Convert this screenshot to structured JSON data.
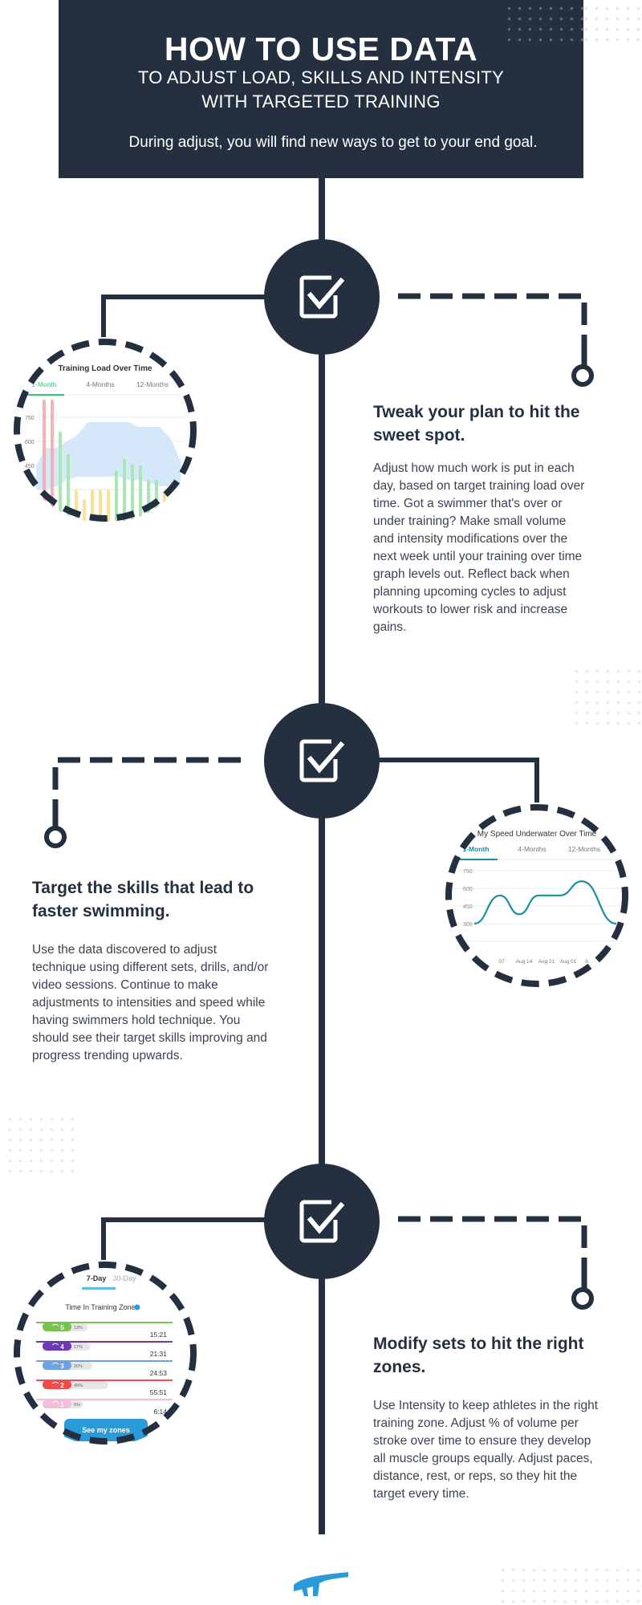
{
  "header": {
    "title": "HOW TO USE DATA",
    "subtitle_line1": "TO ADJUST LOAD, SKILLS AND INTENSITY",
    "subtitle_line2": "WITH TARGETED TRAINING",
    "tagline": "During adjust, you will find new ways to get to your end goal."
  },
  "colors": {
    "navy": "#243040",
    "green": "#2ecc71",
    "teal": "#1a8fa0",
    "blue": "#2a9ad8"
  },
  "icons": {
    "step_icon": "checkbox-checked-icon",
    "end_icon": "circle-terminal-icon",
    "logo": "brand-logo"
  },
  "sections": [
    {
      "title": "Tweak your plan to hit the sweet spot.",
      "body": "Adjust how much work is put in each day, based on target training load over time. Got a swimmer that's over or under training? Make small volume and intensity modifications over the next week until your training over time graph levels out. Reflect back when planning upcoming cycles to adjust workouts to lower risk and increase gains."
    },
    {
      "title": "Target the skills that lead to faster swimming.",
      "body": "Use the data discovered to adjust technique using different sets, drills, and/or video sessions. Continue to make adjustments to intensities and speed while having swimmers hold technique. You should see their target skills improving and progress trending upwards."
    },
    {
      "title": "Modify sets to hit the right zones.",
      "body": "Use Intensity to keep athletes in the right training zone. Adjust % of volume per stroke over time to ensure they develop all muscle groups equally. Adjust paces, distance, rest, or reps, so they hit the target every time."
    }
  ],
  "chart_data": [
    {
      "type": "bar",
      "title": "Training Load Over Time",
      "tabs": [
        "1-Month",
        "4-Months",
        "12-Months"
      ],
      "active_tab": "1-Month",
      "yticks": [
        "750",
        "600",
        "450"
      ],
      "ylim": [
        150,
        900
      ],
      "target_band_upper": [
        450,
        560,
        560,
        600,
        640,
        720,
        720,
        720,
        720,
        720,
        690,
        690,
        690,
        620,
        480
      ],
      "target_band_lower": [
        300,
        300,
        320,
        360,
        380,
        380,
        380,
        380,
        380,
        360,
        360,
        340,
        320,
        320,
        300
      ],
      "bars": [
        {
          "value": 860,
          "status": "over"
        },
        {
          "value": 860,
          "status": "over"
        },
        {
          "value": 660,
          "status": "ok"
        },
        {
          "value": 520,
          "status": "ok"
        },
        {
          "value": 300,
          "status": "under"
        },
        {
          "value": 240,
          "status": "under"
        },
        {
          "value": 300,
          "status": "under"
        },
        {
          "value": 300,
          "status": "under"
        },
        {
          "value": 300,
          "status": "under"
        },
        {
          "value": 420,
          "status": "ok"
        },
        {
          "value": 490,
          "status": "ok"
        },
        {
          "value": 460,
          "status": "ok"
        },
        {
          "value": 450,
          "status": "ok"
        },
        {
          "value": 360,
          "status": "ok"
        },
        {
          "value": 360,
          "status": "ok"
        },
        {
          "value": 280,
          "status": "under"
        }
      ],
      "bar_colors": {
        "over": "#f0b4b4",
        "ok": "#a8e6b4",
        "under": "#fbe29a"
      }
    },
    {
      "type": "line",
      "title": "My Speed Underwater Over Time",
      "tabs": [
        "1-Month",
        "4-Months",
        "12-Months"
      ],
      "active_tab": "1-Month",
      "yticks": [
        "750",
        "600",
        "450",
        "300"
      ],
      "ylim": [
        150,
        800
      ],
      "xticks": [
        "07",
        "Aug 14",
        "Aug 21",
        "Aug 01",
        "A"
      ],
      "series": [
        {
          "name": "speed",
          "values": [
            300,
            540,
            380,
            540,
            540,
            660,
            300
          ]
        }
      ]
    },
    {
      "type": "table",
      "title": "Time In Training Zone",
      "tabs": [
        "7-Day",
        "30-Day"
      ],
      "active_tab": "7-Day",
      "rows": [
        {
          "zone": "5",
          "percent": 13,
          "time": "15:21",
          "color": "#7cc04e"
        },
        {
          "zone": "4",
          "percent": 17,
          "time": "21:31",
          "color": "#6a3bb5"
        },
        {
          "zone": "3",
          "percent": 20,
          "time": "24:53",
          "color": "#6fa3e0"
        },
        {
          "zone": "2",
          "percent": 45,
          "time": "55:51",
          "color": "#ef4b4b"
        },
        {
          "zone": "1",
          "percent": 5,
          "time": "6:14",
          "color": "#f2bdd8"
        }
      ],
      "button_label": "See my zones"
    }
  ]
}
